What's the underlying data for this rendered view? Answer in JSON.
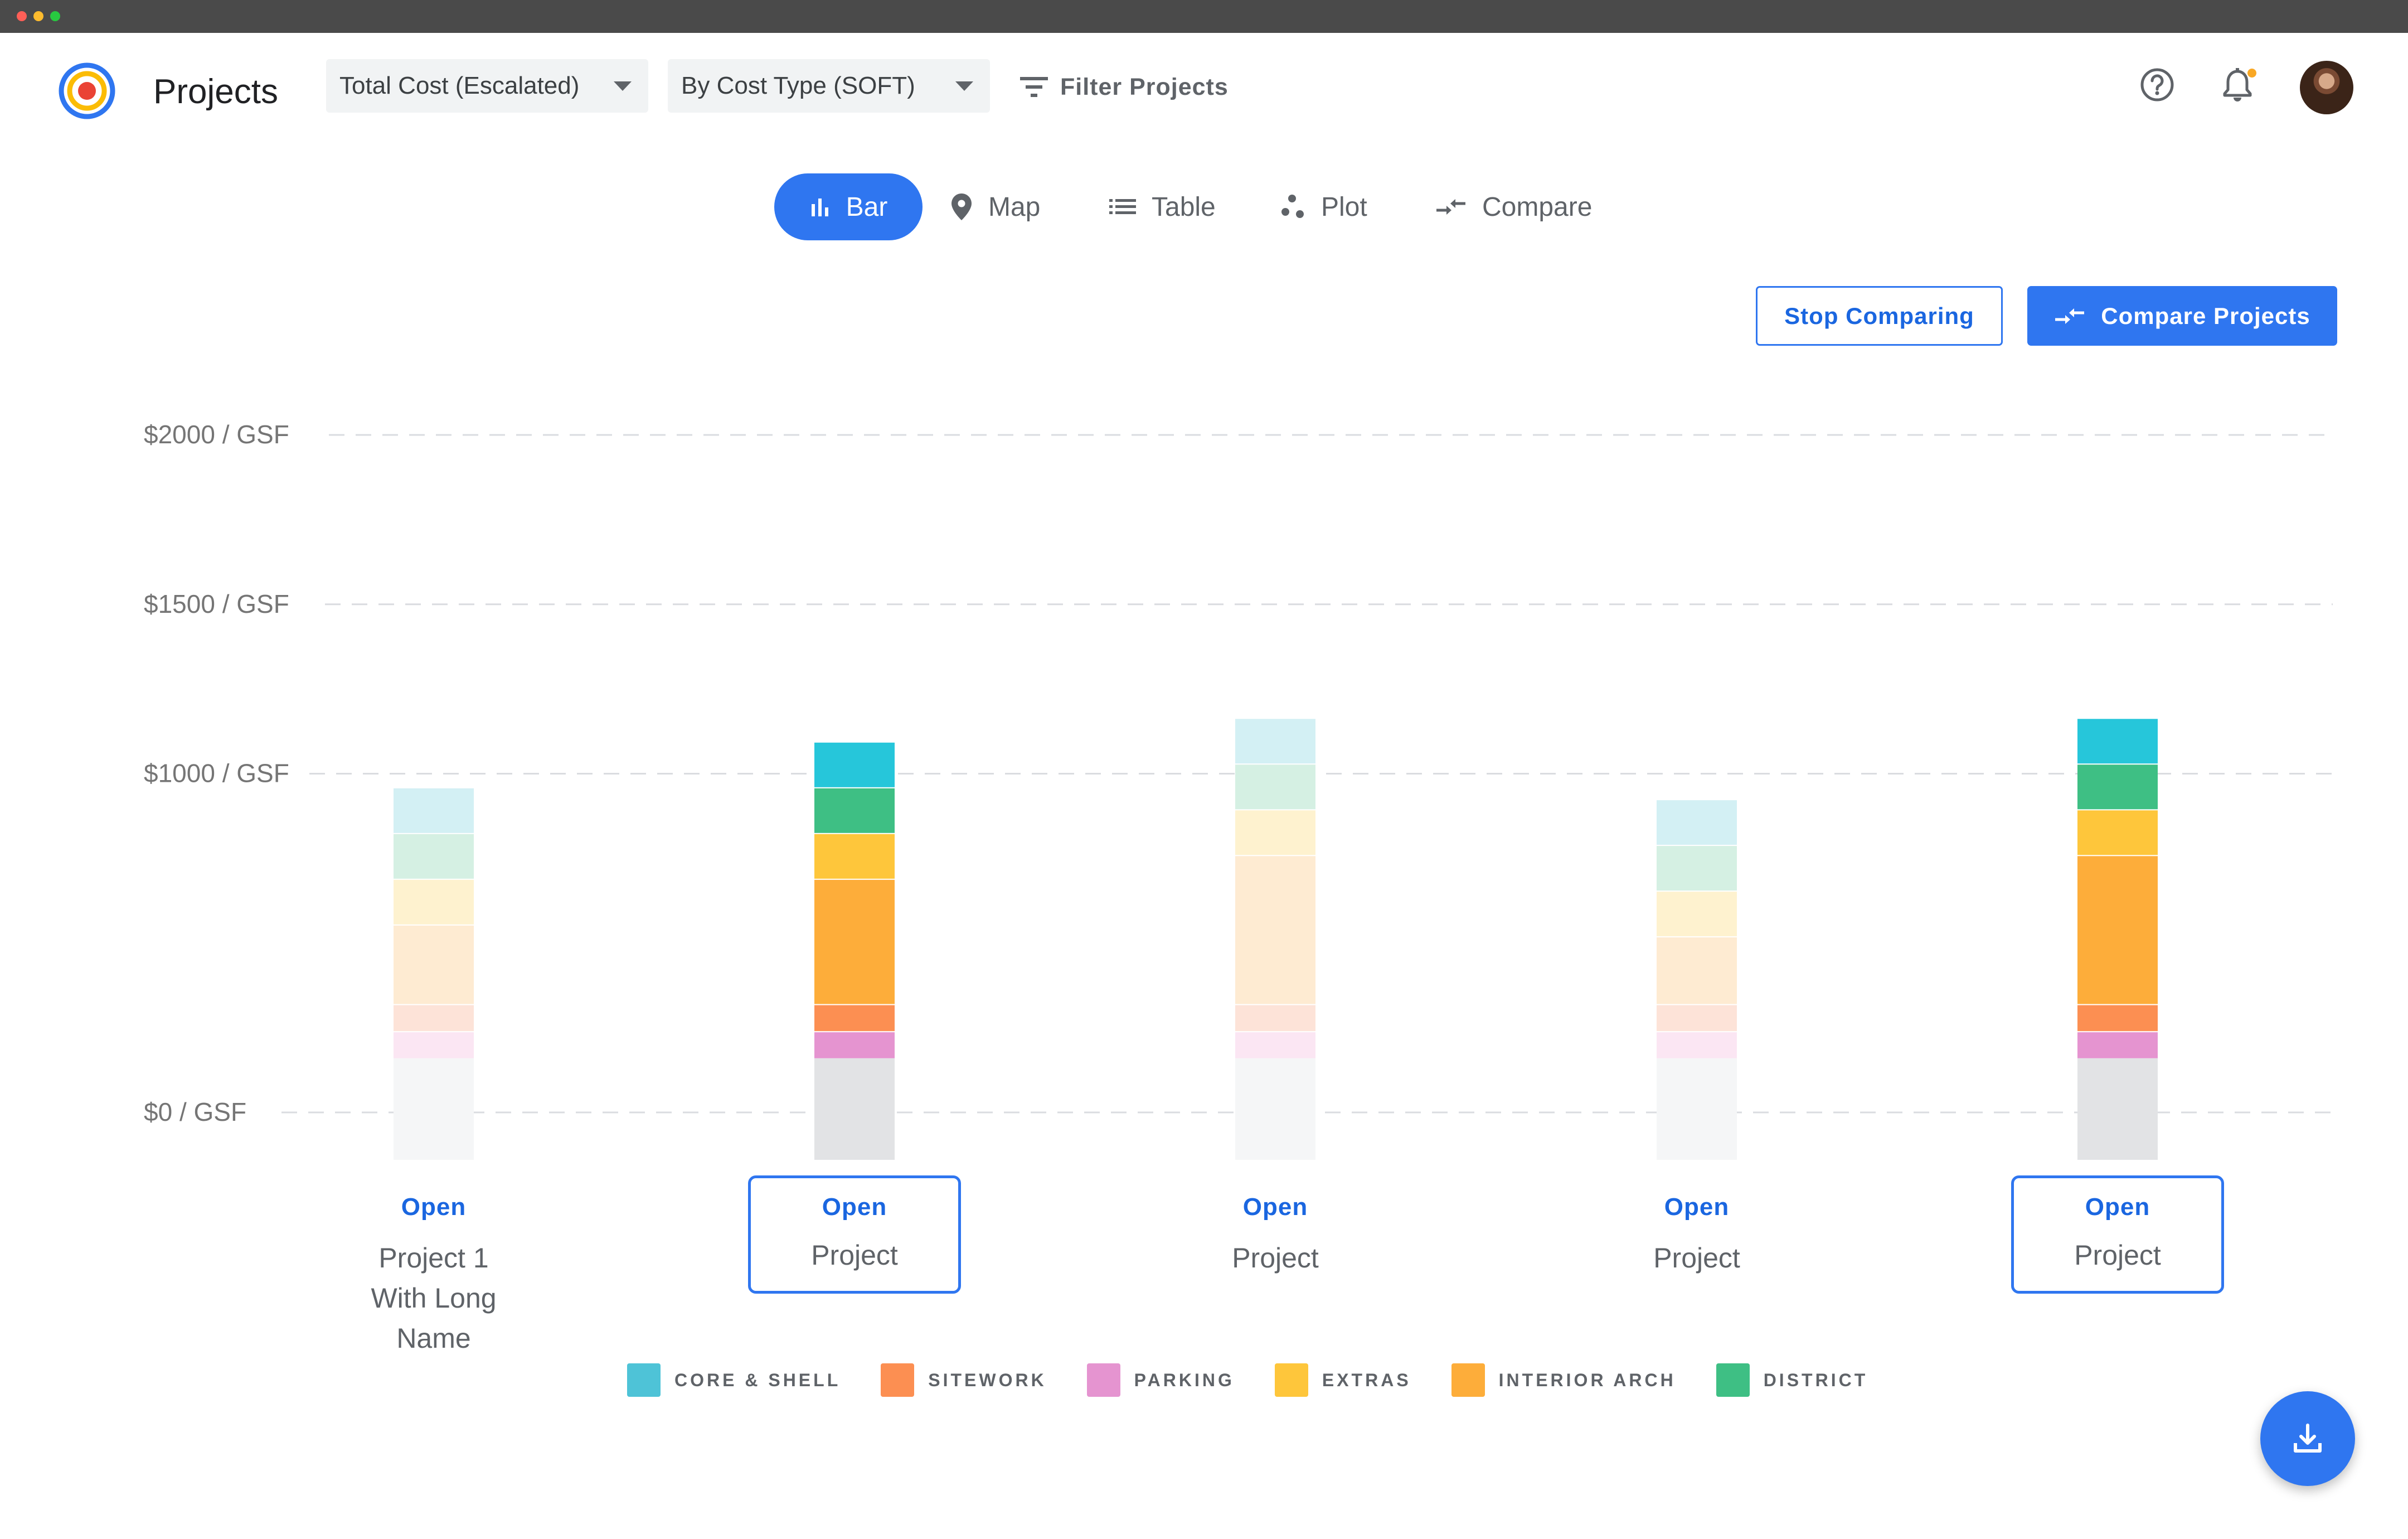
{
  "window": {
    "dots": [
      "#ff5f57",
      "#febc2e",
      "#28c840"
    ]
  },
  "header": {
    "title": "Projects",
    "metric_select": "Total Cost (Escalated)",
    "breakdown_select": "By Cost Type (SOFT)",
    "filter_label": "Filter Projects",
    "icons": [
      "help-icon",
      "notification-bell-icon",
      "avatar"
    ]
  },
  "tabs": [
    {
      "label": "Bar",
      "icon": "bar-chart-icon",
      "active": true
    },
    {
      "label": "Map",
      "icon": "map-pin-icon",
      "active": false
    },
    {
      "label": "Table",
      "icon": "list-icon",
      "active": false
    },
    {
      "label": "Plot",
      "icon": "scatter-icon",
      "active": false
    },
    {
      "label": "Compare",
      "icon": "compare-arrows-icon",
      "active": false
    }
  ],
  "actions": {
    "stop_comparing": "Stop Comparing",
    "compare_projects": "Compare Projects"
  },
  "colors": {
    "accent": "#2f76f0",
    "base_selected": "#e2e3e5",
    "base_faded": "#f5f6f7",
    "CORE & SHELL": "#4ec3d7",
    "SITEWORK": "#fc8f52",
    "PARKING": "#e594d0",
    "EXTRAS": "#fec63b",
    "INTERIOR ARCH": "#fdad3a",
    "DISTRICT": "#3ebf84"
  },
  "chart_data": {
    "type": "bar",
    "stacked": true,
    "yticks": [
      "$2000 / GSF",
      "$1500 / GSF",
      "$1000 / GSF",
      "$0 / GSF"
    ],
    "ylim": [
      0,
      2000
    ],
    "grid": true,
    "legend_position": "bottom",
    "categories": [
      "Project 1 With Long Name",
      "Project",
      "Project",
      "Project",
      "Project"
    ],
    "selected": [
      false,
      true,
      false,
      false,
      true
    ],
    "series": [
      {
        "name": "BASE",
        "values": [
          0,
          0,
          0,
          0,
          0
        ]
      },
      {
        "name": "PARKING",
        "values": [
          80,
          80,
          80,
          80,
          80
        ]
      },
      {
        "name": "SITEWORK",
        "values": [
          80,
          80,
          80,
          80,
          80
        ]
      },
      {
        "name": "INTERIOR ARCH",
        "values": [
          235,
          370,
          440,
          200,
          440
        ]
      },
      {
        "name": "EXTRAS",
        "values": [
          135,
          135,
          135,
          135,
          135
        ]
      },
      {
        "name": "DISTRICT",
        "values": [
          135,
          135,
          135,
          135,
          135
        ]
      },
      {
        "name": "CORE & SHELL",
        "values": [
          135,
          135,
          135,
          135,
          135
        ]
      }
    ],
    "base_below_zero_note": "",
    "legend": [
      "CORE & SHELL",
      "SITEWORK",
      "PARKING",
      "EXTRAS",
      "INTERIOR ARCH",
      "DISTRICT"
    ],
    "open_label": "Open"
  },
  "fab": {
    "icon": "download-icon"
  }
}
